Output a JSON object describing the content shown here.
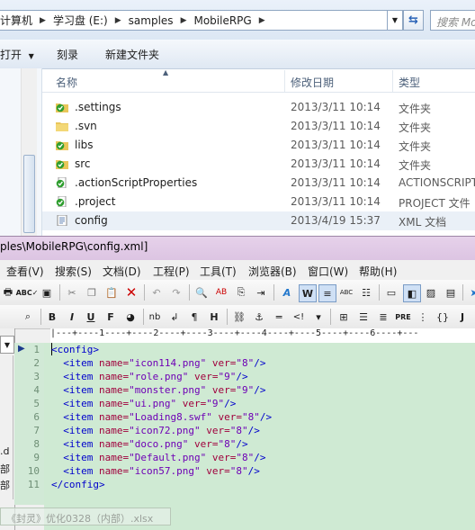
{
  "explorer": {
    "breadcrumb": [
      "计算机",
      "学习盘 (E:)",
      "samples",
      "MobileRPG"
    ],
    "search_placeholder": "搜索 Mo",
    "commands": [
      "打开",
      "刻录",
      "新建文件夹"
    ],
    "columns": {
      "name": "名称",
      "date": "修改日期",
      "type": "类型"
    },
    "files": [
      {
        "name": ".settings",
        "date": "2013/3/11 10:14",
        "type": "文件夹",
        "icon": "svn-folder-icon"
      },
      {
        "name": ".svn",
        "date": "2013/3/11 10:14",
        "type": "文件夹",
        "icon": "folder-icon"
      },
      {
        "name": "libs",
        "date": "2013/3/11 10:14",
        "type": "文件夹",
        "icon": "svn-folder-icon"
      },
      {
        "name": "src",
        "date": "2013/3/11 10:14",
        "type": "文件夹",
        "icon": "svn-folder-icon"
      },
      {
        "name": ".actionScriptProperties",
        "date": "2013/3/11 10:14",
        "type": "ACTIONSCRIPT",
        "icon": "svn-file-icon"
      },
      {
        "name": ".project",
        "date": "2013/3/11 10:14",
        "type": "PROJECT 文件",
        "icon": "svn-file-icon"
      },
      {
        "name": "config",
        "date": "2013/4/19 15:37",
        "type": "XML 文档",
        "icon": "xml-file-icon"
      }
    ]
  },
  "editor": {
    "title": "ples\\MobileRPG\\config.xml]",
    "menu": [
      "查看(V)",
      "搜索(S)",
      "文档(D)",
      "工程(P)",
      "工具(T)",
      "浏览器(B)",
      "窗口(W)",
      "帮助(H)"
    ],
    "ruler": "|---+----1----+----2----+----3----+----4----+----5----+----6----+---",
    "left_labels": [
      ".d",
      "部",
      "部"
    ],
    "code": [
      {
        "n": "1",
        "indent": "",
        "open": "<config>"
      },
      {
        "n": "2",
        "indent": "  ",
        "tag": "<item",
        "file": "\"icon114.png\"",
        "ver": "\"8\""
      },
      {
        "n": "3",
        "indent": "  ",
        "tag": "<item",
        "file": "\"role.png\"",
        "ver": "\"9\""
      },
      {
        "n": "4",
        "indent": "  ",
        "tag": "<item",
        "file": "\"monster.png\"",
        "ver": "\"9\""
      },
      {
        "n": "5",
        "indent": "  ",
        "tag": "<item",
        "file": "\"ui.png\"",
        "ver": "\"9\""
      },
      {
        "n": "6",
        "indent": "  ",
        "tag": "<item",
        "file": "\"Loading8.swf\"",
        "ver": "\"8\""
      },
      {
        "n": "7",
        "indent": "  ",
        "tag": "<item",
        "file": "\"icon72.png\"",
        "ver": "\"8\""
      },
      {
        "n": "8",
        "indent": "  ",
        "tag": "<item",
        "file": "\"doco.png\"",
        "ver": "\"8\""
      },
      {
        "n": "9",
        "indent": "  ",
        "tag": "<item",
        "file": "\"Default.png\"",
        "ver": "\"8\""
      },
      {
        "n": "10",
        "indent": "  ",
        "tag": "<item",
        "file": "\"icon57.png\"",
        "ver": "\"8\""
      },
      {
        "n": "11",
        "indent": "",
        "open": "</config>"
      }
    ],
    "attr_name": "name=",
    "attr_ver": "ver=",
    "close": "/>",
    "taskbar_item": "《封灵》优化0328（内部）.xlsx"
  }
}
